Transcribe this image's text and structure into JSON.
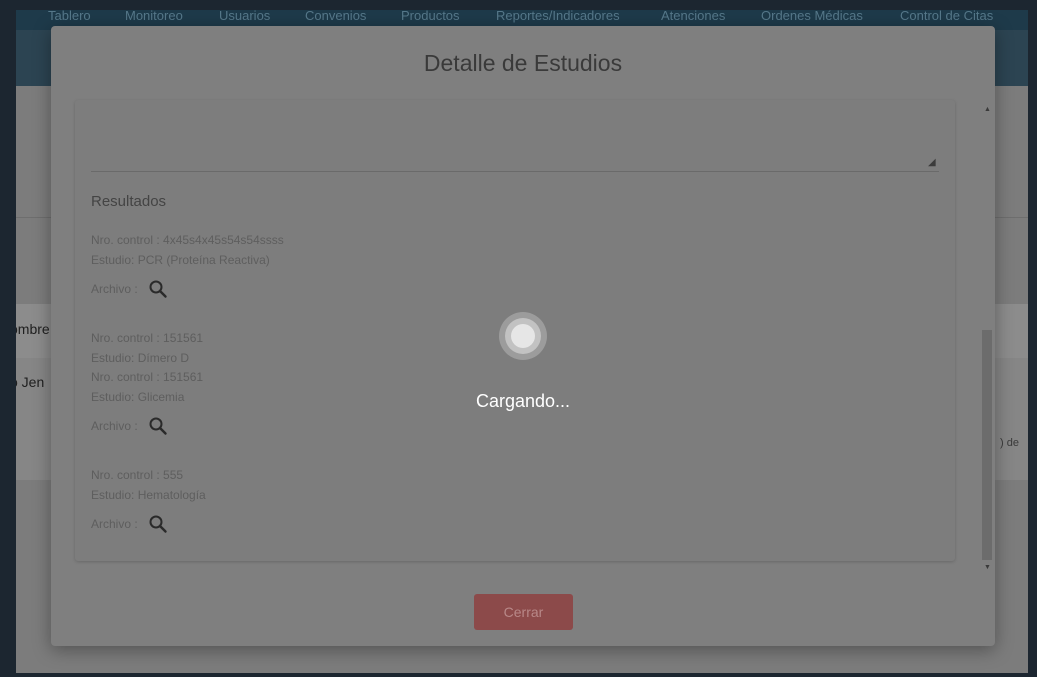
{
  "nav": {
    "items": [
      "Tablero",
      "Monitoreo",
      "Usuarios",
      "Convenios",
      "Productos",
      "Reportes/Indicadores",
      "Atenciones",
      "Ordenes Médicas",
      "Control de Citas"
    ]
  },
  "background": {
    "column_header_fragment": "ombre",
    "row_fragment": "o Jen",
    "pagination_fragment": ") de"
  },
  "modal": {
    "title": "Detalle de Estudios",
    "results_title": "Resultados",
    "results": [
      {
        "lines": [
          "Nro. control : 4x45s4x45s54s54ssss",
          "Estudio: PCR (Proteína Reactiva)"
        ],
        "file_label": "Archivo :"
      },
      {
        "lines": [
          "Nro. control : 151561",
          "Estudio: Dímero D",
          "Nro. control : 151561",
          "Estudio: Glicemia"
        ],
        "file_label": "Archivo :"
      },
      {
        "lines": [
          "Nro. control : 555",
          "Estudio: Hematología"
        ],
        "file_label": "Archivo :"
      }
    ],
    "close_label": "Cerrar"
  },
  "loader": {
    "text": "Cargando..."
  },
  "icons": {
    "file_view": "search-icon",
    "resize": "resize-handle-icon"
  },
  "colors": {
    "close_button": "#8c4a4a",
    "overlay_text": "#ffffff"
  }
}
